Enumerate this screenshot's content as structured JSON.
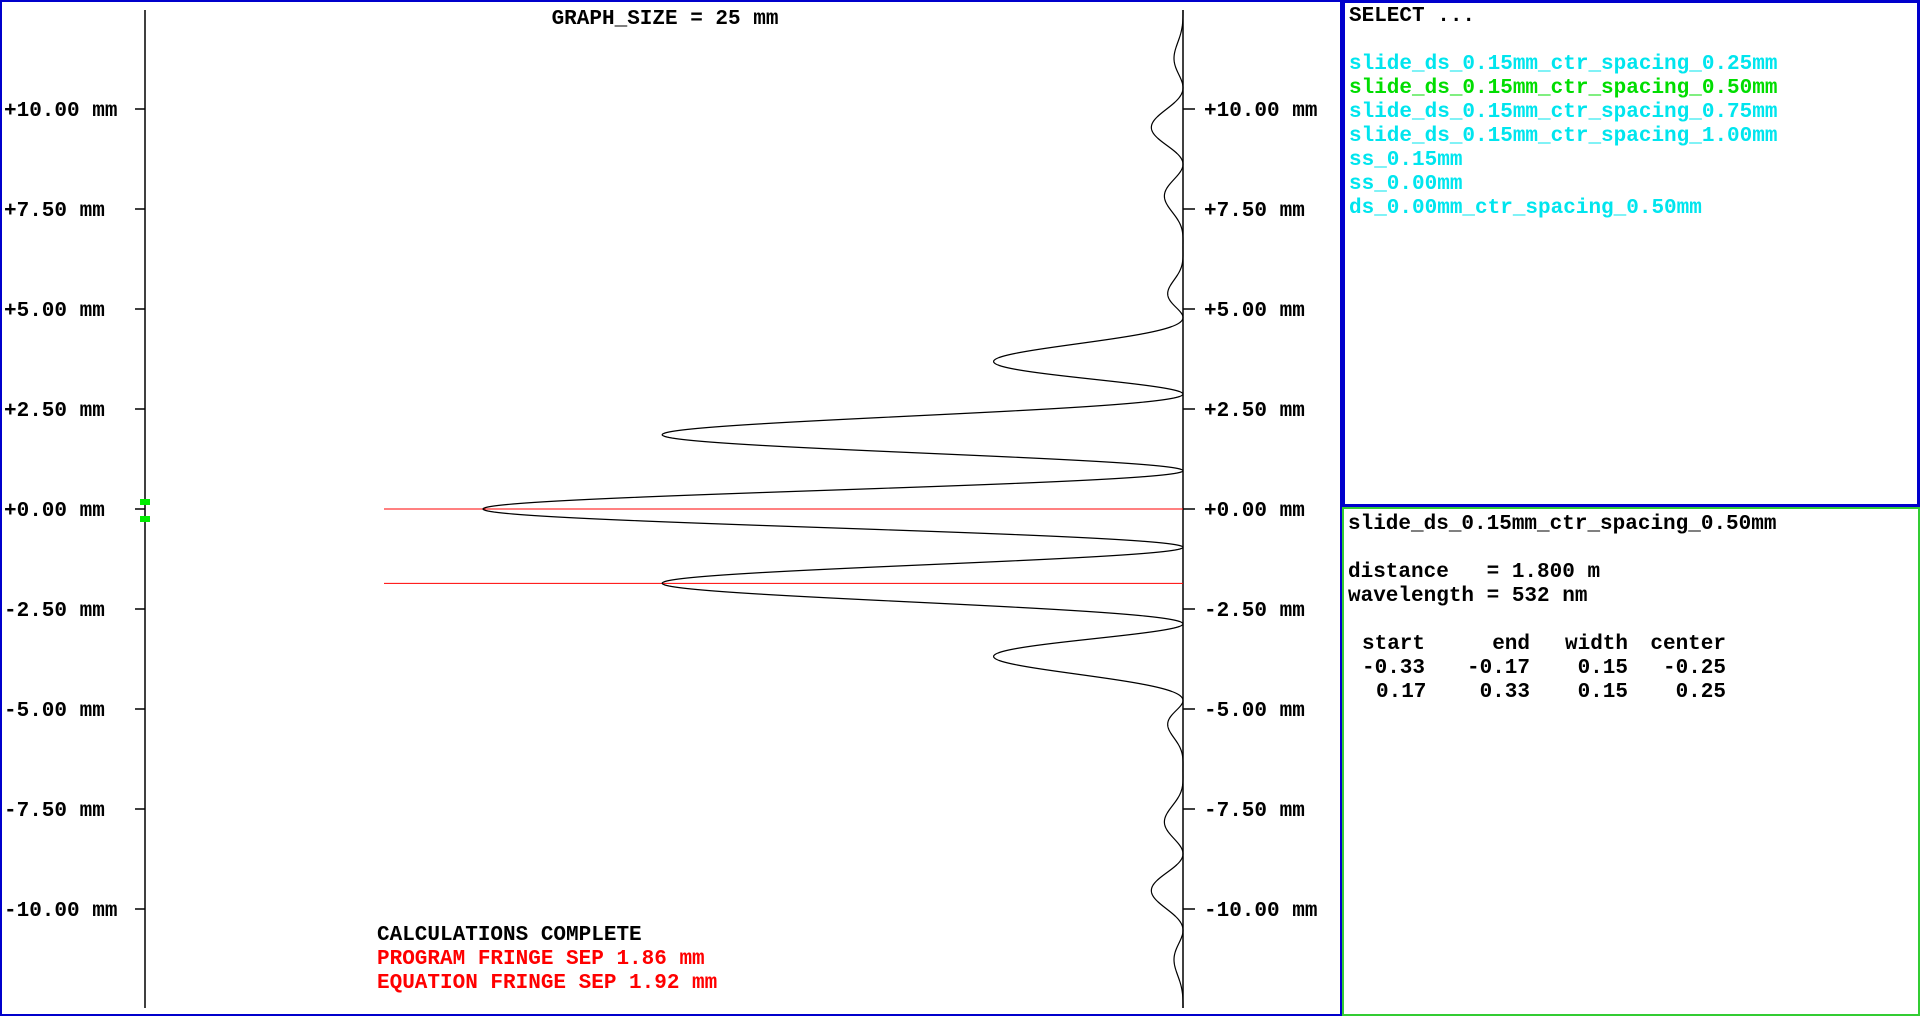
{
  "graph": {
    "title": "GRAPH_SIZE = 25 mm",
    "graph_size_mm": 25,
    "tick_labels": [
      "+10.00 mm",
      "+7.50 mm",
      "+5.00 mm",
      "+2.50 mm",
      "+0.00 mm",
      "-2.50 mm",
      "-5.00 mm",
      "-7.50 mm",
      "-10.00 mm"
    ],
    "tick_values_mm": [
      10,
      7.5,
      5,
      2.5,
      0,
      -2.5,
      -5,
      -7.5,
      -10
    ],
    "marker_lines_mm": [
      0,
      -1.86
    ],
    "status": "CALCULATIONS COMPLETE",
    "program_fringe": "PROGRAM FRINGE SEP  1.86 mm",
    "equation_fringe": "EQUATION FRINGE SEP 1.92 mm",
    "colors": {
      "axis": "#000000",
      "marker": "#ff0000",
      "status": "#000000",
      "fringe_text": "#ff0000",
      "handle": "#00ee00"
    }
  },
  "select": {
    "header": "SELECT ...",
    "items": [
      {
        "label": "slide_ds_0.15mm_ctr_spacing_0.25mm",
        "selected": false
      },
      {
        "label": "slide_ds_0.15mm_ctr_spacing_0.50mm",
        "selected": true
      },
      {
        "label": "slide_ds_0.15mm_ctr_spacing_0.75mm",
        "selected": false
      },
      {
        "label": "slide_ds_0.15mm_ctr_spacing_1.00mm",
        "selected": false
      },
      {
        "label": "ss_0.15mm",
        "selected": false
      },
      {
        "label": "ss_0.00mm",
        "selected": false
      },
      {
        "label": "ds_0.00mm_ctr_spacing_0.50mm",
        "selected": false
      }
    ],
    "colors": {
      "item": "#00e5ee",
      "selected": "#00dd00"
    }
  },
  "info": {
    "name": "slide_ds_0.15mm_ctr_spacing_0.50mm",
    "distance": "distance   = 1.800 m",
    "wavelength": "wavelength = 532 nm",
    "table": {
      "headers": [
        "start",
        "end",
        "width",
        "center"
      ],
      "rows": [
        [
          "-0.33",
          "-0.17",
          "0.15",
          "-0.25"
        ],
        [
          "0.17",
          "0.33",
          "0.15",
          "0.25"
        ]
      ]
    }
  },
  "intensity": {
    "slit_width_mm": 0.15,
    "slit_separation_mm": 0.5,
    "wavelength_nm": 532,
    "distance_m": 1.8
  }
}
